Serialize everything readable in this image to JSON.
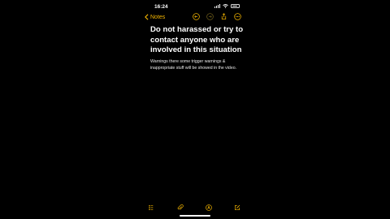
{
  "status": {
    "time": "16:24"
  },
  "nav": {
    "back_label": "Notes"
  },
  "note": {
    "title": "Do not harassed or try to contact anyone who are involved in this situation",
    "body": "Warnings there some trigger warnings & inappropriate stuff will be showed in the video."
  },
  "colors": {
    "accent": "#f2b400",
    "background": "#000000",
    "text": "#ffffff"
  },
  "icons": {
    "nav": [
      "undo-icon",
      "redo-icon",
      "share-icon",
      "more-icon"
    ],
    "toolbar": [
      "checklist-icon",
      "attachment-icon",
      "markup-icon",
      "compose-icon"
    ]
  }
}
